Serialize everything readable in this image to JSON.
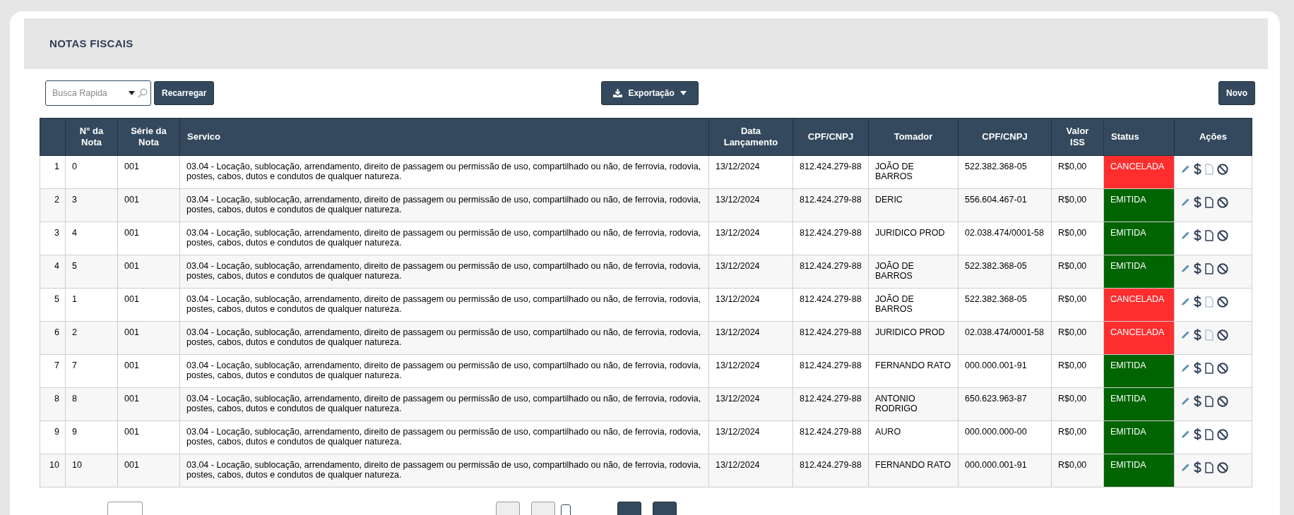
{
  "page_title": "NOTAS FISCAIS",
  "toolbar": {
    "search": {
      "placeholder": "Busca Rapida"
    },
    "reload_button": "Recarregar",
    "export_button": "Exportação",
    "new_button": "Novo"
  },
  "table": {
    "columns": [
      "",
      "N° da Nota",
      "Série da Nota",
      "Servico",
      "Data Lançamento",
      "CPF/CNPJ",
      "Tomador",
      "CPF/CNPJ",
      "Valor ISS",
      "Status",
      "Ações"
    ],
    "rows": [
      {
        "index": "1",
        "numero": "0",
        "serie": "001",
        "servico": "03.04 - Locação, sublocação, arrendamento, direito de passagem ou permissão de uso, compartilhado ou não, de ferrovia, rodovia, postes, cabos, dutos e condutos de qualquer natureza.",
        "data": "13/12/2024",
        "cpf_cnpj": "812.424.279-88",
        "tomador": "JOÃO DE BARROS",
        "cpf_cnpj_tomador": "522.382.368-05",
        "valor_iss": "R$0,00",
        "status": {
          "label": "CANCELADA",
          "color": "#ff2e2e"
        },
        "file_enabled": false
      },
      {
        "index": "2",
        "numero": "3",
        "serie": "001",
        "servico": "03.04 - Locação, sublocação, arrendamento, direito de passagem ou permissão de uso, compartilhado ou não, de ferrovia, rodovia, postes, cabos, dutos e condutos de qualquer natureza.",
        "data": "13/12/2024",
        "cpf_cnpj": "812.424.279-88",
        "tomador": "DERIC",
        "cpf_cnpj_tomador": "556.604.467-01",
        "valor_iss": "R$0,00",
        "status": {
          "label": "EMITIDA",
          "color": "#006400"
        },
        "file_enabled": true
      },
      {
        "index": "3",
        "numero": "4",
        "serie": "001",
        "servico": "03.04 - Locação, sublocação, arrendamento, direito de passagem ou permissão de uso, compartilhado ou não, de ferrovia, rodovia, postes, cabos, dutos e condutos de qualquer natureza.",
        "data": "13/12/2024",
        "cpf_cnpj": "812.424.279-88",
        "tomador": "JURIDICO PROD",
        "cpf_cnpj_tomador": "02.038.474/0001-58",
        "valor_iss": "R$0,00",
        "status": {
          "label": "EMITIDA",
          "color": "#006400"
        },
        "file_enabled": true
      },
      {
        "index": "4",
        "numero": "5",
        "serie": "001",
        "servico": "03.04 - Locação, sublocação, arrendamento, direito de passagem ou permissão de uso, compartilhado ou não, de ferrovia, rodovia, postes, cabos, dutos e condutos de qualquer natureza.",
        "data": "13/12/2024",
        "cpf_cnpj": "812.424.279-88",
        "tomador": "JOÃO DE BARROS",
        "cpf_cnpj_tomador": "522.382.368-05",
        "valor_iss": "R$0,00",
        "status": {
          "label": "EMITIDA",
          "color": "#006400"
        },
        "file_enabled": true
      },
      {
        "index": "5",
        "numero": "1",
        "serie": "001",
        "servico": "03.04 - Locação, sublocação, arrendamento, direito de passagem ou permissão de uso, compartilhado ou não, de ferrovia, rodovia, postes, cabos, dutos e condutos de qualquer natureza.",
        "data": "13/12/2024",
        "cpf_cnpj": "812.424.279-88",
        "tomador": "JOÃO DE BARROS",
        "cpf_cnpj_tomador": "522.382.368-05",
        "valor_iss": "R$0,00",
        "status": {
          "label": "CANCELADA",
          "color": "#ff2e2e"
        },
        "file_enabled": false
      },
      {
        "index": "6",
        "numero": "2",
        "serie": "001",
        "servico": "03.04 - Locação, sublocação, arrendamento, direito de passagem ou permissão de uso, compartilhado ou não, de ferrovia, rodovia, postes, cabos, dutos e condutos de qualquer natureza.",
        "data": "13/12/2024",
        "cpf_cnpj": "812.424.279-88",
        "tomador": "JURIDICO PROD",
        "cpf_cnpj_tomador": "02.038.474/0001-58",
        "valor_iss": "R$0,00",
        "status": {
          "label": "CANCELADA",
          "color": "#ff2e2e"
        },
        "file_enabled": false
      },
      {
        "index": "7",
        "numero": "7",
        "serie": "001",
        "servico": "03.04 - Locação, sublocação, arrendamento, direito de passagem ou permissão de uso, compartilhado ou não, de ferrovia, rodovia, postes, cabos, dutos e condutos de qualquer natureza.",
        "data": "13/12/2024",
        "cpf_cnpj": "812.424.279-88",
        "tomador": "FERNANDO RATO",
        "cpf_cnpj_tomador": "000.000.001-91",
        "valor_iss": "R$0,00",
        "status": {
          "label": "EMITIDA",
          "color": "#006400"
        },
        "file_enabled": true
      },
      {
        "index": "8",
        "numero": "8",
        "serie": "001",
        "servico": "03.04 - Locação, sublocação, arrendamento, direito de passagem ou permissão de uso, compartilhado ou não, de ferrovia, rodovia, postes, cabos, dutos e condutos de qualquer natureza.",
        "data": "13/12/2024",
        "cpf_cnpj": "812.424.279-88",
        "tomador": "ANTONIO RODRIGO",
        "cpf_cnpj_tomador": "650.623.963-87",
        "valor_iss": "R$0,00",
        "status": {
          "label": "EMITIDA",
          "color": "#006400"
        },
        "file_enabled": true
      },
      {
        "index": "9",
        "numero": "9",
        "serie": "001",
        "servico": "03.04 - Locação, sublocação, arrendamento, direito de passagem ou permissão de uso, compartilhado ou não, de ferrovia, rodovia, postes, cabos, dutos e condutos de qualquer natureza.",
        "data": "13/12/2024",
        "cpf_cnpj": "812.424.279-88",
        "tomador": "AURO",
        "cpf_cnpj_tomador": "000.000.000-00",
        "valor_iss": "R$0,00",
        "status": {
          "label": "EMITIDA",
          "color": "#006400"
        },
        "file_enabled": true
      },
      {
        "index": "10",
        "numero": "10",
        "serie": "001",
        "servico": "03.04 - Locação, sublocação, arrendamento, direito de passagem ou permissão de uso, compartilhado ou não, de ferrovia, rodovia, postes, cabos, dutos e condutos de qualquer natureza.",
        "data": "13/12/2024",
        "cpf_cnpj": "812.424.279-88",
        "tomador": "FERNANDO RATO",
        "cpf_cnpj_tomador": "000.000.001-91",
        "valor_iss": "R$0,00",
        "status": {
          "label": "EMITIDA",
          "color": "#006400"
        },
        "file_enabled": true
      }
    ]
  }
}
